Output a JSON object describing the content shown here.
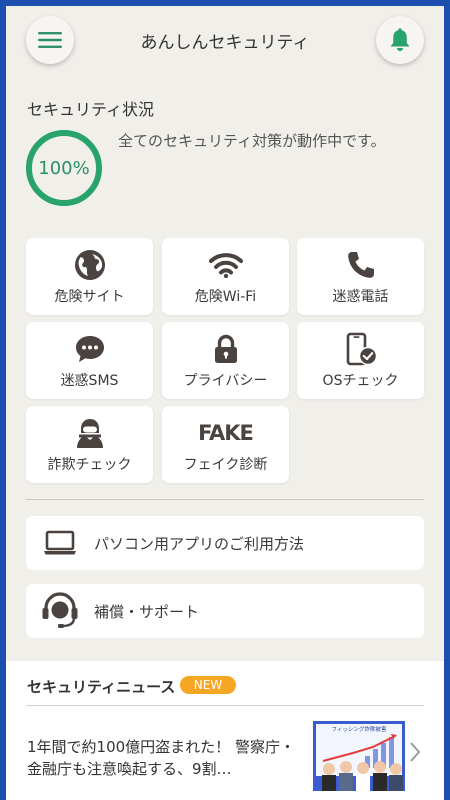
{
  "header": {
    "title": "あんしんセキュリティ",
    "menu_icon": "hamburger-menu-icon",
    "bell_icon": "bell-icon"
  },
  "status": {
    "heading": "セキュリティ状況",
    "percent_label": "100%",
    "percent": 100,
    "message": "全てのセキュリティ対策が動作中です。"
  },
  "tiles": [
    {
      "label": "危険サイト",
      "icon": "globe-icon"
    },
    {
      "label": "危険Wi-Fi",
      "icon": "wifi-icon"
    },
    {
      "label": "迷惑電話",
      "icon": "phone-icon"
    },
    {
      "label": "迷惑SMS",
      "icon": "sms-bubble-icon"
    },
    {
      "label": "プライバシー",
      "icon": "lock-icon"
    },
    {
      "label": "OSチェック",
      "icon": "smartphone-check-icon"
    },
    {
      "label": "詐欺チェック",
      "icon": "hacker-icon"
    },
    {
      "label": "フェイク診断",
      "icon": "fake-text-icon",
      "icon_text": "FAKE"
    }
  ],
  "cards": [
    {
      "label": "パソコン用アプリのご利用方法",
      "icon": "laptop-icon"
    },
    {
      "label": "補償・サポート",
      "icon": "headset-support-icon"
    }
  ],
  "news": {
    "heading": "セキュリティニュース",
    "badge": "NEW",
    "item_title": "1年間で約100億円盗まれた！ 警察庁・金融庁も注意喚起する、9割…",
    "thumbnail_caption": "フィッシング詐欺被害",
    "chevron_icon": "chevron-right-icon"
  },
  "colors": {
    "accent_green": "#2e8f6c",
    "gauge_green": "#27a36b",
    "badge_orange": "#f5a623",
    "icon_brown": "#4a4340",
    "frame_blue": "#1d4fb0"
  }
}
